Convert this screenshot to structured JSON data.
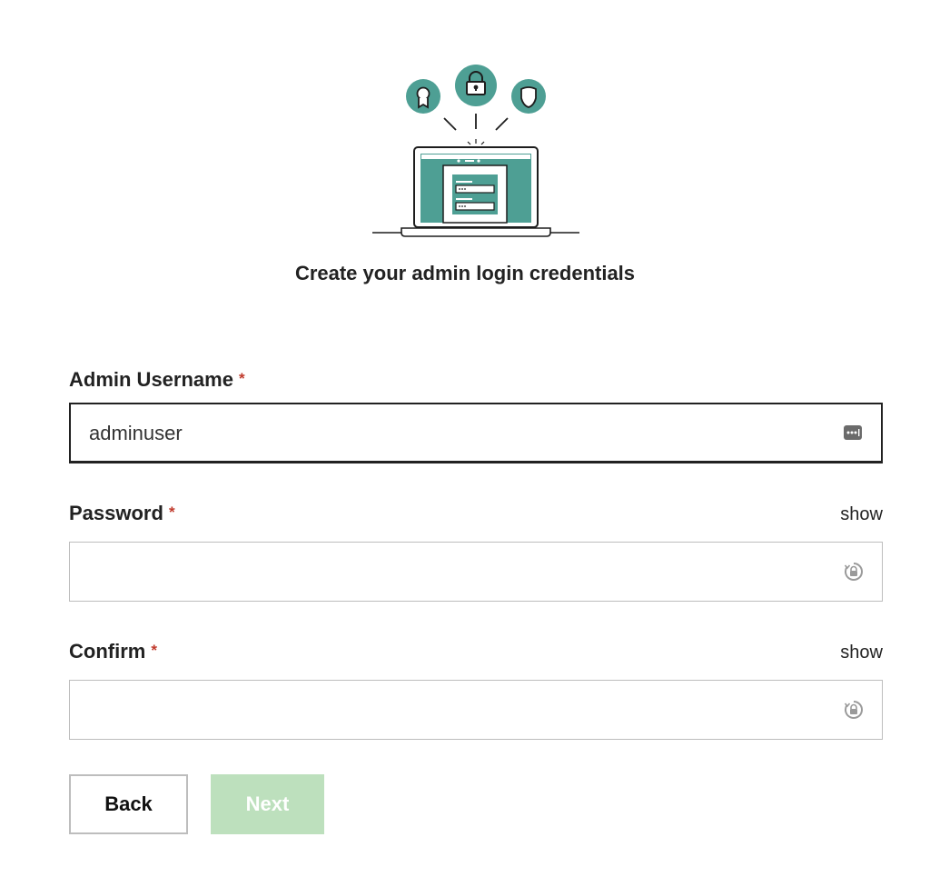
{
  "header": {
    "title": "Create your admin login credentials",
    "illustration_icons": [
      "award-icon",
      "lock-icon",
      "shield-icon",
      "laptop-icon"
    ]
  },
  "form": {
    "username": {
      "label": "Admin Username",
      "required_mark": "*",
      "value": "adminuser",
      "icon": "autofill-dots-icon"
    },
    "password": {
      "label": "Password",
      "required_mark": "*",
      "show_label": "show",
      "value": "",
      "icon": "password-manager-icon"
    },
    "confirm": {
      "label": "Confirm",
      "required_mark": "*",
      "show_label": "show",
      "value": "",
      "icon": "password-manager-icon"
    }
  },
  "buttons": {
    "back_label": "Back",
    "next_label": "Next"
  },
  "colors": {
    "accent_teal": "#4e9f94",
    "required_red": "#c0392b",
    "next_disabled_green": "#bde0bd"
  }
}
